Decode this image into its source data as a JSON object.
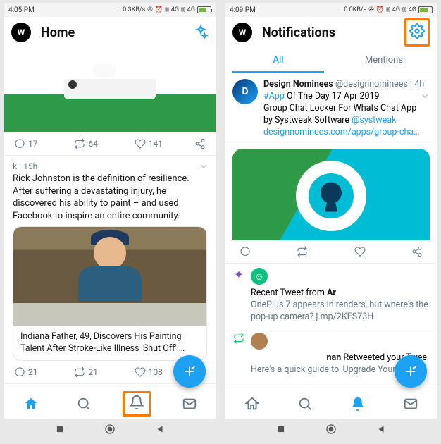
{
  "left": {
    "status": {
      "time": "4:05 PM",
      "speed": "0.3KB/s",
      "net1": "4G",
      "net2": "4G"
    },
    "header": {
      "title": "Home"
    },
    "post1": {
      "replies": "17",
      "retweets": "64",
      "likes": "141"
    },
    "post2": {
      "meta": "k · 15h",
      "text": "Rick Johnston is the definition of resilience. After suffering a devastating injury, he discovered his ability to paint  – and used Facebook to inspire an entire community.",
      "caption": "Indiana Father, 49, Discovers His Painting Talent After Stroke-Like Illness 'Shut Off' …",
      "replies": "21",
      "retweets": "21",
      "likes": "108"
    }
  },
  "right": {
    "status": {
      "time": "4:09 PM",
      "speed": "0.0KB/s",
      "net1": "4G",
      "net2": "4G"
    },
    "header": {
      "title": "Notifications"
    },
    "tabs": {
      "all": "All",
      "mentions": "Mentions"
    },
    "notif1": {
      "name": "Design Nominees",
      "handle": "@designnominees",
      "age": "· 4h",
      "hashtag": "#App",
      "line1_rest": " Of The Day 17 Apr 2019",
      "line2": "Group Chat Locker For Whats Chat App",
      "line3_pre": "by Systweak Software ",
      "mention": "@systweak",
      "link": "designnominees.com/apps/group-cha…"
    },
    "notif2": {
      "title_pre": "Recent Tweet from ",
      "title_bold": "Ar",
      "body": "OnePlus 7 appears in renders, but where's the pop-up camera? j.mp/2KES73H"
    },
    "notif3": {
      "title_suffix": " Retweeted your Twee",
      "title_bold": "nan",
      "body": "Here's a quick guide to 'Upgrade Your"
    }
  }
}
